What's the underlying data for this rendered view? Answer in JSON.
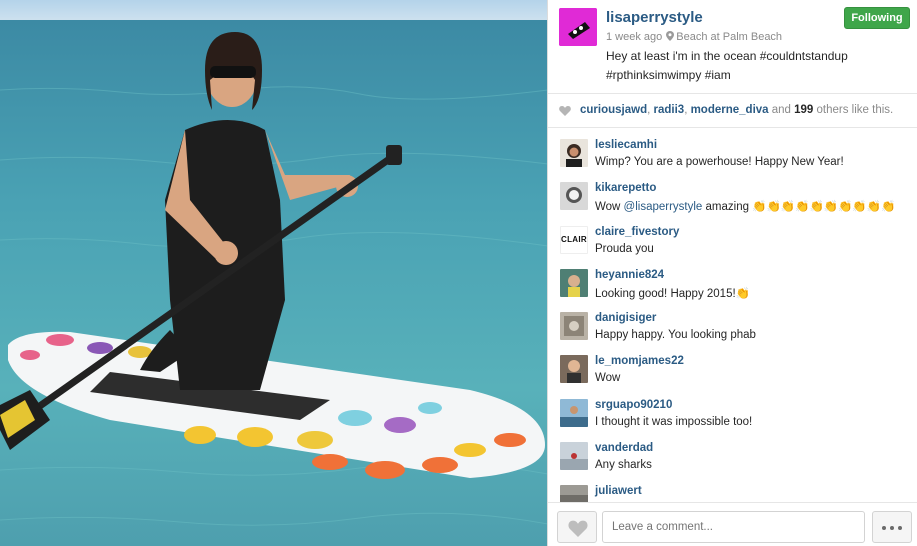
{
  "post": {
    "username": "lisaperrystyle",
    "follow_label": "Following",
    "time_ago": "1 week ago",
    "location": "Beach at Palm Beach",
    "caption_line1": "Hey at least i'm in the ocean #couldntstandup",
    "caption_line2": "#rpthinksimwimpy #iam"
  },
  "likes": {
    "user1": "curiousjawd",
    "sep1": ", ",
    "user2": "radii3",
    "sep2": ", ",
    "user3": "moderne_diva",
    "and": " and ",
    "count": "199",
    "others": " others like this."
  },
  "comments": [
    {
      "user": "lesliecamhi",
      "text": "Wimp? You are a powerhouse! Happy New Year!"
    },
    {
      "user": "kikarepetto",
      "prefix": "Wow ",
      "mention": "@lisaperrystyle",
      "text": " amazing 👏👏👏👏👏👏👏👏👏👏"
    },
    {
      "user": "claire_fivestory",
      "text": "Prouda you",
      "avatar_text": "CLAIRE"
    },
    {
      "user": "heyannie824",
      "text": "Looking good! Happy 2015!👏"
    },
    {
      "user": "danigisiger",
      "text": "Happy happy. You looking phab"
    },
    {
      "user": "le_momjames22",
      "text": "Wow"
    },
    {
      "user": "srguapo90210",
      "text": "I thought it was impossible too!"
    },
    {
      "user": "vanderdad",
      "text": "Any sharks"
    },
    {
      "user": "juliawert",
      "text": ""
    }
  ],
  "footer": {
    "comment_placeholder": "Leave a comment..."
  },
  "colors": {
    "link": "#2b5b84",
    "follow_green": "#3fa64a",
    "owner_avatar": "#e02ad6"
  },
  "icons": [
    "heart-icon",
    "location-pin-icon",
    "more-options-icon"
  ]
}
